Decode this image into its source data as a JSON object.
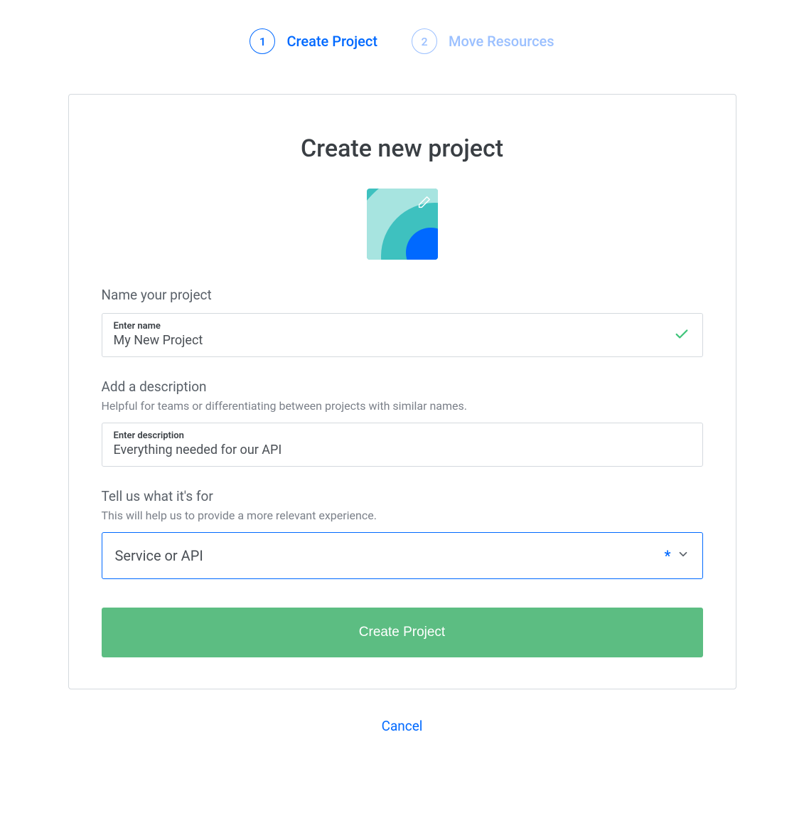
{
  "stepper": {
    "steps": [
      {
        "num": "1",
        "label": "Create Project",
        "state": "active"
      },
      {
        "num": "2",
        "label": "Move Resources",
        "state": "inactive"
      }
    ]
  },
  "card": {
    "title": "Create new project",
    "avatar_icon": "pencil-icon"
  },
  "form": {
    "name": {
      "group_label": "Name your project",
      "field_label": "Enter name",
      "value": "My New Project",
      "valid": true
    },
    "description": {
      "group_label": "Add a description",
      "hint": "Helpful for teams or differentiating between projects with similar names.",
      "field_label": "Enter description",
      "value": "Everything needed for our API"
    },
    "purpose": {
      "group_label": "Tell us what it's for",
      "hint": "This will help us to provide a more relevant experience.",
      "selected": "Service or API",
      "required_marker": "*"
    },
    "submit_label": "Create Project",
    "cancel_label": "Cancel"
  }
}
